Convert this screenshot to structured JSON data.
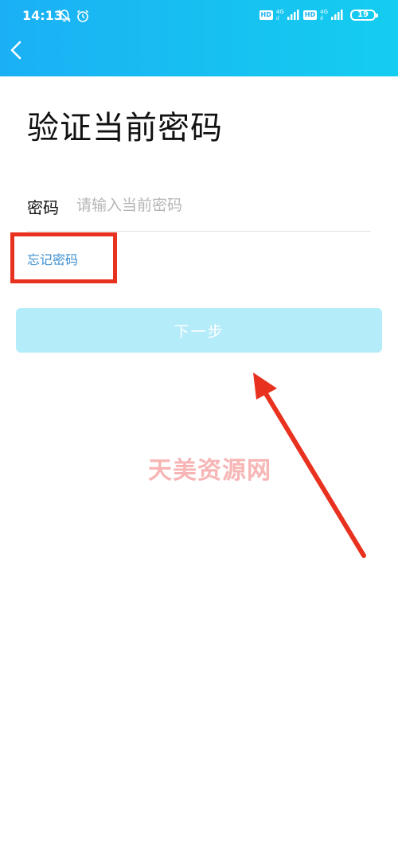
{
  "status_bar": {
    "time": "14:13",
    "hd_label": "HD",
    "network_type": "4G",
    "network_sub": "ıl",
    "battery": "19"
  },
  "header": {
    "back_icon": "chevron-left-icon"
  },
  "page": {
    "title": "验证当前密码"
  },
  "form": {
    "password_label": "密码",
    "password_placeholder": "请输入当前密码",
    "password_value": "",
    "forgot_label": "忘记密码",
    "next_label": "下一步"
  },
  "overlay": {
    "watermark": "天美资源网"
  },
  "colors": {
    "header_start": "#1bb0f5",
    "header_end": "#14cdf0",
    "link": "#3c8fd1",
    "button_disabled": "#b5ecfa",
    "annotation": "#e8321f"
  }
}
